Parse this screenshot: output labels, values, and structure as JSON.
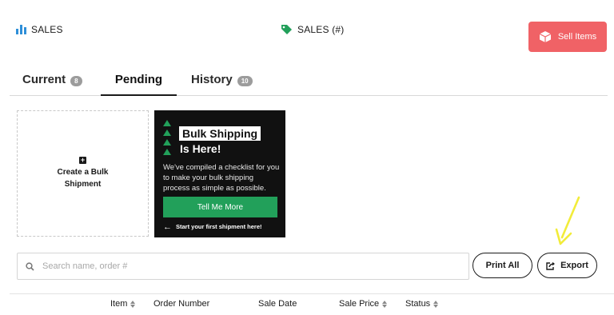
{
  "stats": {
    "sales_label": "SALES",
    "sales_count_label": "SALES (#)"
  },
  "header": {
    "sell_items_label": "Sell Items"
  },
  "tabs": [
    {
      "label": "Current",
      "badge": "8"
    },
    {
      "label": "Pending",
      "badge": ""
    },
    {
      "label": "History",
      "badge": "10"
    }
  ],
  "bulk": {
    "line1": "Create a Bulk",
    "line2": "Shipment"
  },
  "promo": {
    "title_line1": "Bulk Shipping",
    "title_line2": "Is Here!",
    "body": "We've compiled a checklist for you to make your bulk shipping process as simple as possible.",
    "button_label": "Tell Me More",
    "footer": "Start your first shipment here!"
  },
  "search": {
    "placeholder": "Search name, order #",
    "value": ""
  },
  "actions": {
    "print_all": "Print All",
    "export": "Export"
  },
  "table": {
    "columns": [
      "Item",
      "Order Number",
      "Sale Date",
      "Sale Price",
      "Status"
    ]
  },
  "colors": {
    "accent_red": "#f06266",
    "accent_green": "#22a05a",
    "chart_blue": "#2f8fd8",
    "annotation_yellow": "#f2ec3a"
  }
}
